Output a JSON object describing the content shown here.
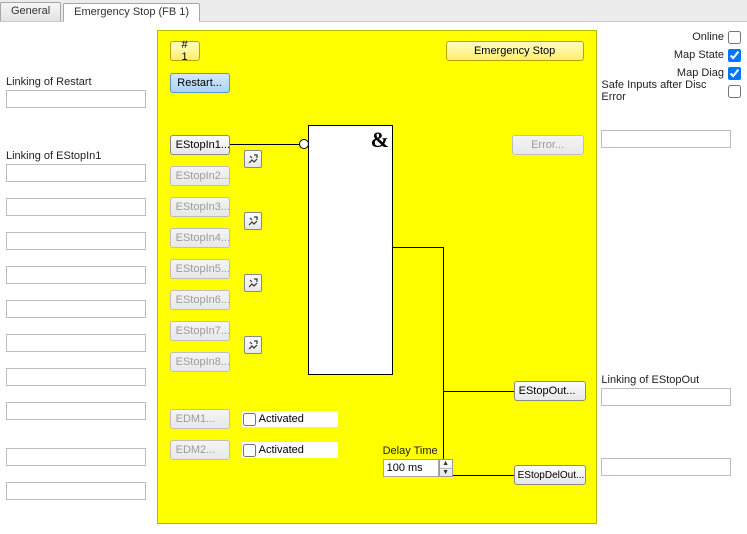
{
  "tabs": {
    "general": "General",
    "estop": "Emergency Stop (FB 1)"
  },
  "left": {
    "linking_restart": "Linking of Restart",
    "linking_estopin1": "Linking of EStopIn1"
  },
  "center": {
    "index_btn": "# 1",
    "emergency_btn": "Emergency Stop",
    "restart_btn": "Restart...",
    "inputs": [
      "EStopIn1...",
      "EStopIn2...",
      "EStopIn3...",
      "EStopIn4...",
      "EStopIn5...",
      "EStopIn6...",
      "EStopIn7...",
      "EStopIn8..."
    ],
    "amp": "&",
    "error_btn": "Error...",
    "edm1": "EDM1...",
    "edm2": "EDM2...",
    "activated": "Activated",
    "delay_label": "Delay Time",
    "delay_value": "100 ms",
    "estopout": "EStopOut...",
    "estopdelout": "EStopDelOut..."
  },
  "right": {
    "online": "Online",
    "map_state": "Map State",
    "map_diag": "Map Diag",
    "safe_inputs": "Safe Inputs after Disc Error",
    "linking_estopout": "Linking of EStopOut"
  }
}
